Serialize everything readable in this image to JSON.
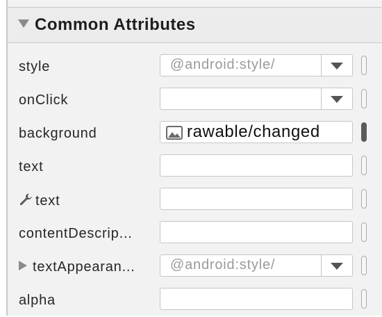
{
  "section": {
    "title": "Common Attributes"
  },
  "rows": [
    {
      "label": "style",
      "type": "combo",
      "value": "@android:style/"
    },
    {
      "label": "onClick",
      "type": "combo",
      "value": ""
    },
    {
      "label": "background",
      "type": "drawable",
      "value": "rawable/changed"
    },
    {
      "label": "text",
      "type": "text",
      "value": ""
    },
    {
      "label": "text",
      "type": "text",
      "value": "",
      "prefix_icon": "wrench-icon"
    },
    {
      "label": "contentDescrip...",
      "type": "text",
      "value": ""
    },
    {
      "label": "textAppearan...",
      "type": "combo",
      "value": "@android:style/",
      "prefix_icon": "expand-triangle-icon"
    },
    {
      "label": "alpha",
      "type": "text",
      "value": ""
    }
  ]
}
